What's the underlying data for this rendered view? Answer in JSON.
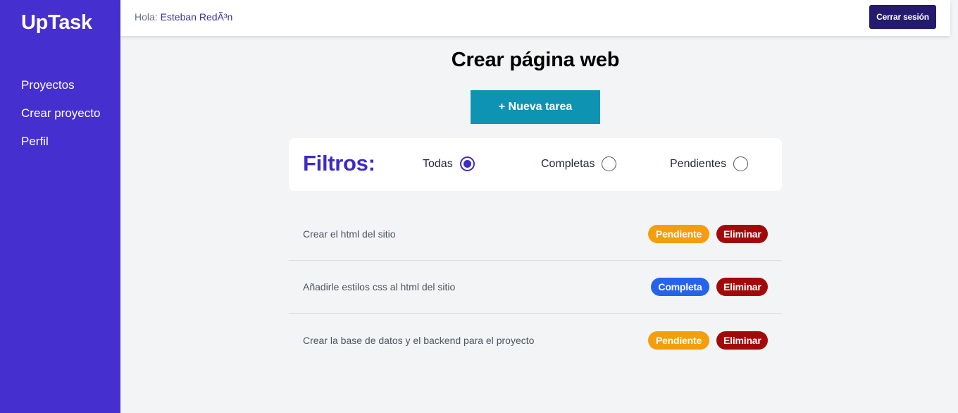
{
  "sidebar": {
    "logo": "UpTask",
    "nav": [
      {
        "label": "Proyectos"
      },
      {
        "label": "Crear proyecto"
      },
      {
        "label": "Perfil"
      }
    ]
  },
  "header": {
    "greeting_prefix": "Hola:",
    "user_name": "Esteban RedÃ³n",
    "logout_label": "Cerrar sesión"
  },
  "main": {
    "title": "Crear página web",
    "new_task_label": "+ Nueva tarea"
  },
  "filters": {
    "title": "Filtros:",
    "options": [
      {
        "label": "Todas",
        "checked": true
      },
      {
        "label": "Completas",
        "checked": false
      },
      {
        "label": "Pendientes",
        "checked": false
      }
    ]
  },
  "tasks": [
    {
      "name": "Crear el html del sitio",
      "status": "Pendiente",
      "delete_label": "Eliminar"
    },
    {
      "name": "Añadirle estilos css al html del sitio",
      "status": "Completa",
      "delete_label": "Eliminar"
    },
    {
      "name": "Crear la base de datos y el backend para el proyecto",
      "status": "Pendiente",
      "delete_label": "Eliminar"
    }
  ],
  "colors": {
    "sidebar": "#4530cf",
    "accent": "#3e2bc4",
    "new_task": "#0e93b3",
    "pending": "#f59e0b",
    "complete": "#2563eb",
    "delete": "#a20a0a"
  }
}
